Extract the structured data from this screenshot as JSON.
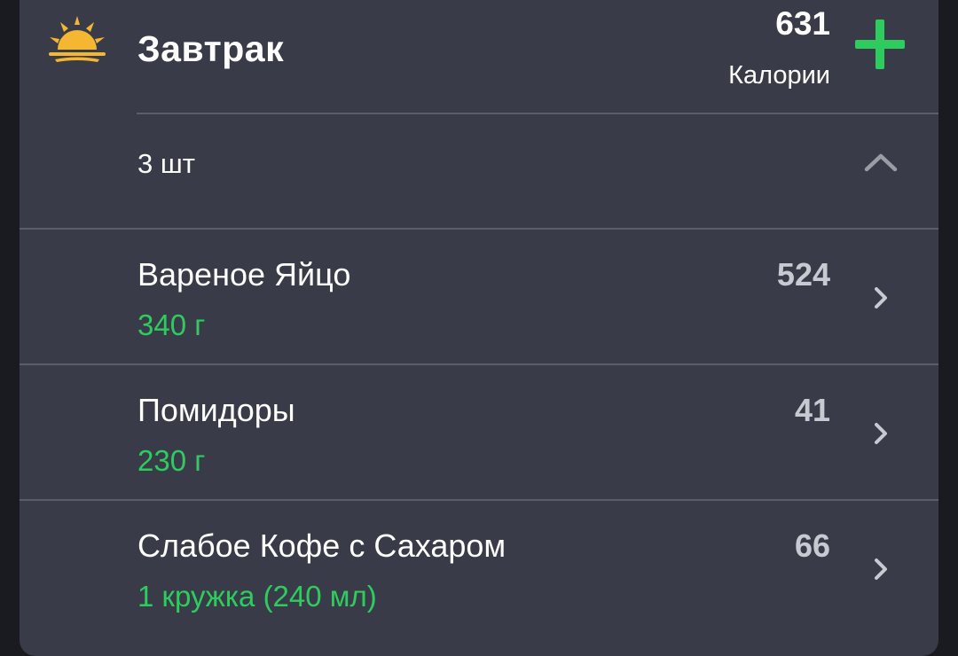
{
  "meal": {
    "title": "Завтрак",
    "icon": "sunrise-icon",
    "calories_value": "631",
    "calories_label": "Калории"
  },
  "summary": {
    "count_label": "3 шт",
    "collapse_icon": "chevron-up-icon"
  },
  "items": [
    {
      "name": "Вареное Яйцо",
      "amount": "340 г",
      "calories": "524"
    },
    {
      "name": "Помидоры",
      "amount": "230 г",
      "calories": "41"
    },
    {
      "name": "Слабое Кофе с Сахаром",
      "amount": "1 кружка (240 мл)",
      "calories": "66"
    }
  ],
  "colors": {
    "background": "#1a1b20",
    "card": "#393c48",
    "accent_green": "#2ecc5f",
    "sun": "#f5b731",
    "divider": "#5b5e6a"
  }
}
